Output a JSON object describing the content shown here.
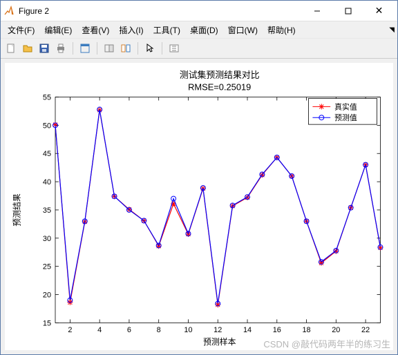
{
  "window": {
    "title": "Figure 2"
  },
  "menu": {
    "file": "文件(F)",
    "edit": "编辑(E)",
    "view": "查看(V)",
    "insert": "插入(I)",
    "tools": "工具(T)",
    "desktop": "桌面(D)",
    "window_": "窗口(W)",
    "help": "帮助(H)"
  },
  "toolbar_icons": {
    "new": "new-figure-icon",
    "open": "open-icon",
    "save": "save-icon",
    "print": "print-icon",
    "dock1": "dock-icon",
    "dock2": "dock-window-icon",
    "link": "linked-axes-icon",
    "cursor": "cursor-icon",
    "insert": "insert-toolbar-icon"
  },
  "chart_data": {
    "type": "line",
    "title": "测试集预测结果对比",
    "subtitle": "RMSE=0.25019",
    "xlabel": "预测样本",
    "ylabel": "预测结果",
    "xlim": [
      1,
      23
    ],
    "ylim": [
      15,
      55
    ],
    "xticks": [
      2,
      4,
      6,
      8,
      10,
      12,
      14,
      16,
      18,
      20,
      22
    ],
    "yticks": [
      15,
      20,
      25,
      30,
      35,
      40,
      45,
      50,
      55
    ],
    "legend": {
      "series1": "真实值",
      "series2": "预测值"
    },
    "x": [
      1,
      2,
      3,
      4,
      5,
      6,
      7,
      8,
      9,
      10,
      11,
      12,
      13,
      14,
      15,
      16,
      17,
      18,
      19,
      20,
      21,
      22,
      23
    ],
    "series": [
      {
        "name": "真实值",
        "color": "#ff0000",
        "marker": "*",
        "values": [
          50.1,
          18.6,
          32.9,
          52.7,
          37.4,
          35.1,
          33.1,
          28.6,
          36.1,
          30.7,
          38.8,
          18.2,
          35.7,
          37.2,
          41.2,
          44.3,
          41.0,
          33.0,
          25.6,
          27.7,
          35.4,
          43.0,
          28.3
        ]
      },
      {
        "name": "预测值",
        "color": "#0000ff",
        "marker": "o",
        "values": [
          50.0,
          19.0,
          33.0,
          52.8,
          37.4,
          35.0,
          33.1,
          28.7,
          37.0,
          30.8,
          38.9,
          18.4,
          35.8,
          37.3,
          41.3,
          44.3,
          41.0,
          33.0,
          25.8,
          27.8,
          35.4,
          43.0,
          28.4
        ]
      }
    ]
  },
  "watermark": "CSDN @敲代码两年半的练习生"
}
